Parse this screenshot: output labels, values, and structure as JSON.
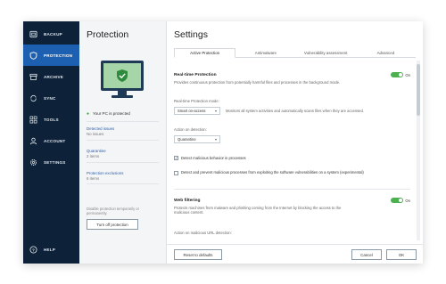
{
  "sidebar": {
    "items": [
      {
        "label": "BACKUP",
        "icon": "backup-icon"
      },
      {
        "label": "PROTECTION",
        "icon": "shield-icon",
        "active": true
      },
      {
        "label": "ARCHIVE",
        "icon": "archive-icon"
      },
      {
        "label": "SYNC",
        "icon": "sync-icon"
      },
      {
        "label": "TOOLS",
        "icon": "tools-icon"
      },
      {
        "label": "ACCOUNT",
        "icon": "account-icon"
      },
      {
        "label": "SETTINGS",
        "icon": "gear-icon"
      }
    ],
    "help": "HELP"
  },
  "protection": {
    "title": "Protection",
    "status": "Your PC is protected",
    "stats": [
      {
        "label": "Detected issues",
        "value": "No issues"
      },
      {
        "label": "Quarantine",
        "value": "2 items"
      },
      {
        "label": "Protection exclusions",
        "value": "6 items"
      }
    ],
    "disable_note": "Disable protection temporarily or permanently.",
    "turn_off": "Turn off protection"
  },
  "settings": {
    "title": "Settings",
    "tabs": [
      "Active Protection",
      "Antimalware",
      "Vulnerability assessment",
      "Advanced"
    ],
    "realtime": {
      "title": "Real-time Protection",
      "state": "On",
      "description": "Provides continuous protection from potentially harmful files and processes in the background mode.",
      "mode_label": "Real-time Protection mode:",
      "mode_value": "Smart on-access",
      "mode_desc": "Monitors all system activities and automatically scans files when they are accessed.",
      "action_label": "Action on detection:",
      "action_value": "Quarantine",
      "check1": "Detect malicious behavior in processes",
      "check2": "Detect and prevent malicious processes from exploiting the software vulnerabilities on a system (experimental)"
    },
    "web": {
      "title": "Web filtering",
      "state": "On",
      "description": "Protects machines from malware and phishing coming from the Internet by blocking the access to the malicious content.",
      "action_label": "Action on malicious URL detection:"
    },
    "reset": "Reset to defaults",
    "cancel": "Cancel",
    "ok": "OK"
  },
  "colors": {
    "sidebar_bg": "#0d2238",
    "active": "#1d5fb0",
    "toggle_on": "#4caf50"
  }
}
